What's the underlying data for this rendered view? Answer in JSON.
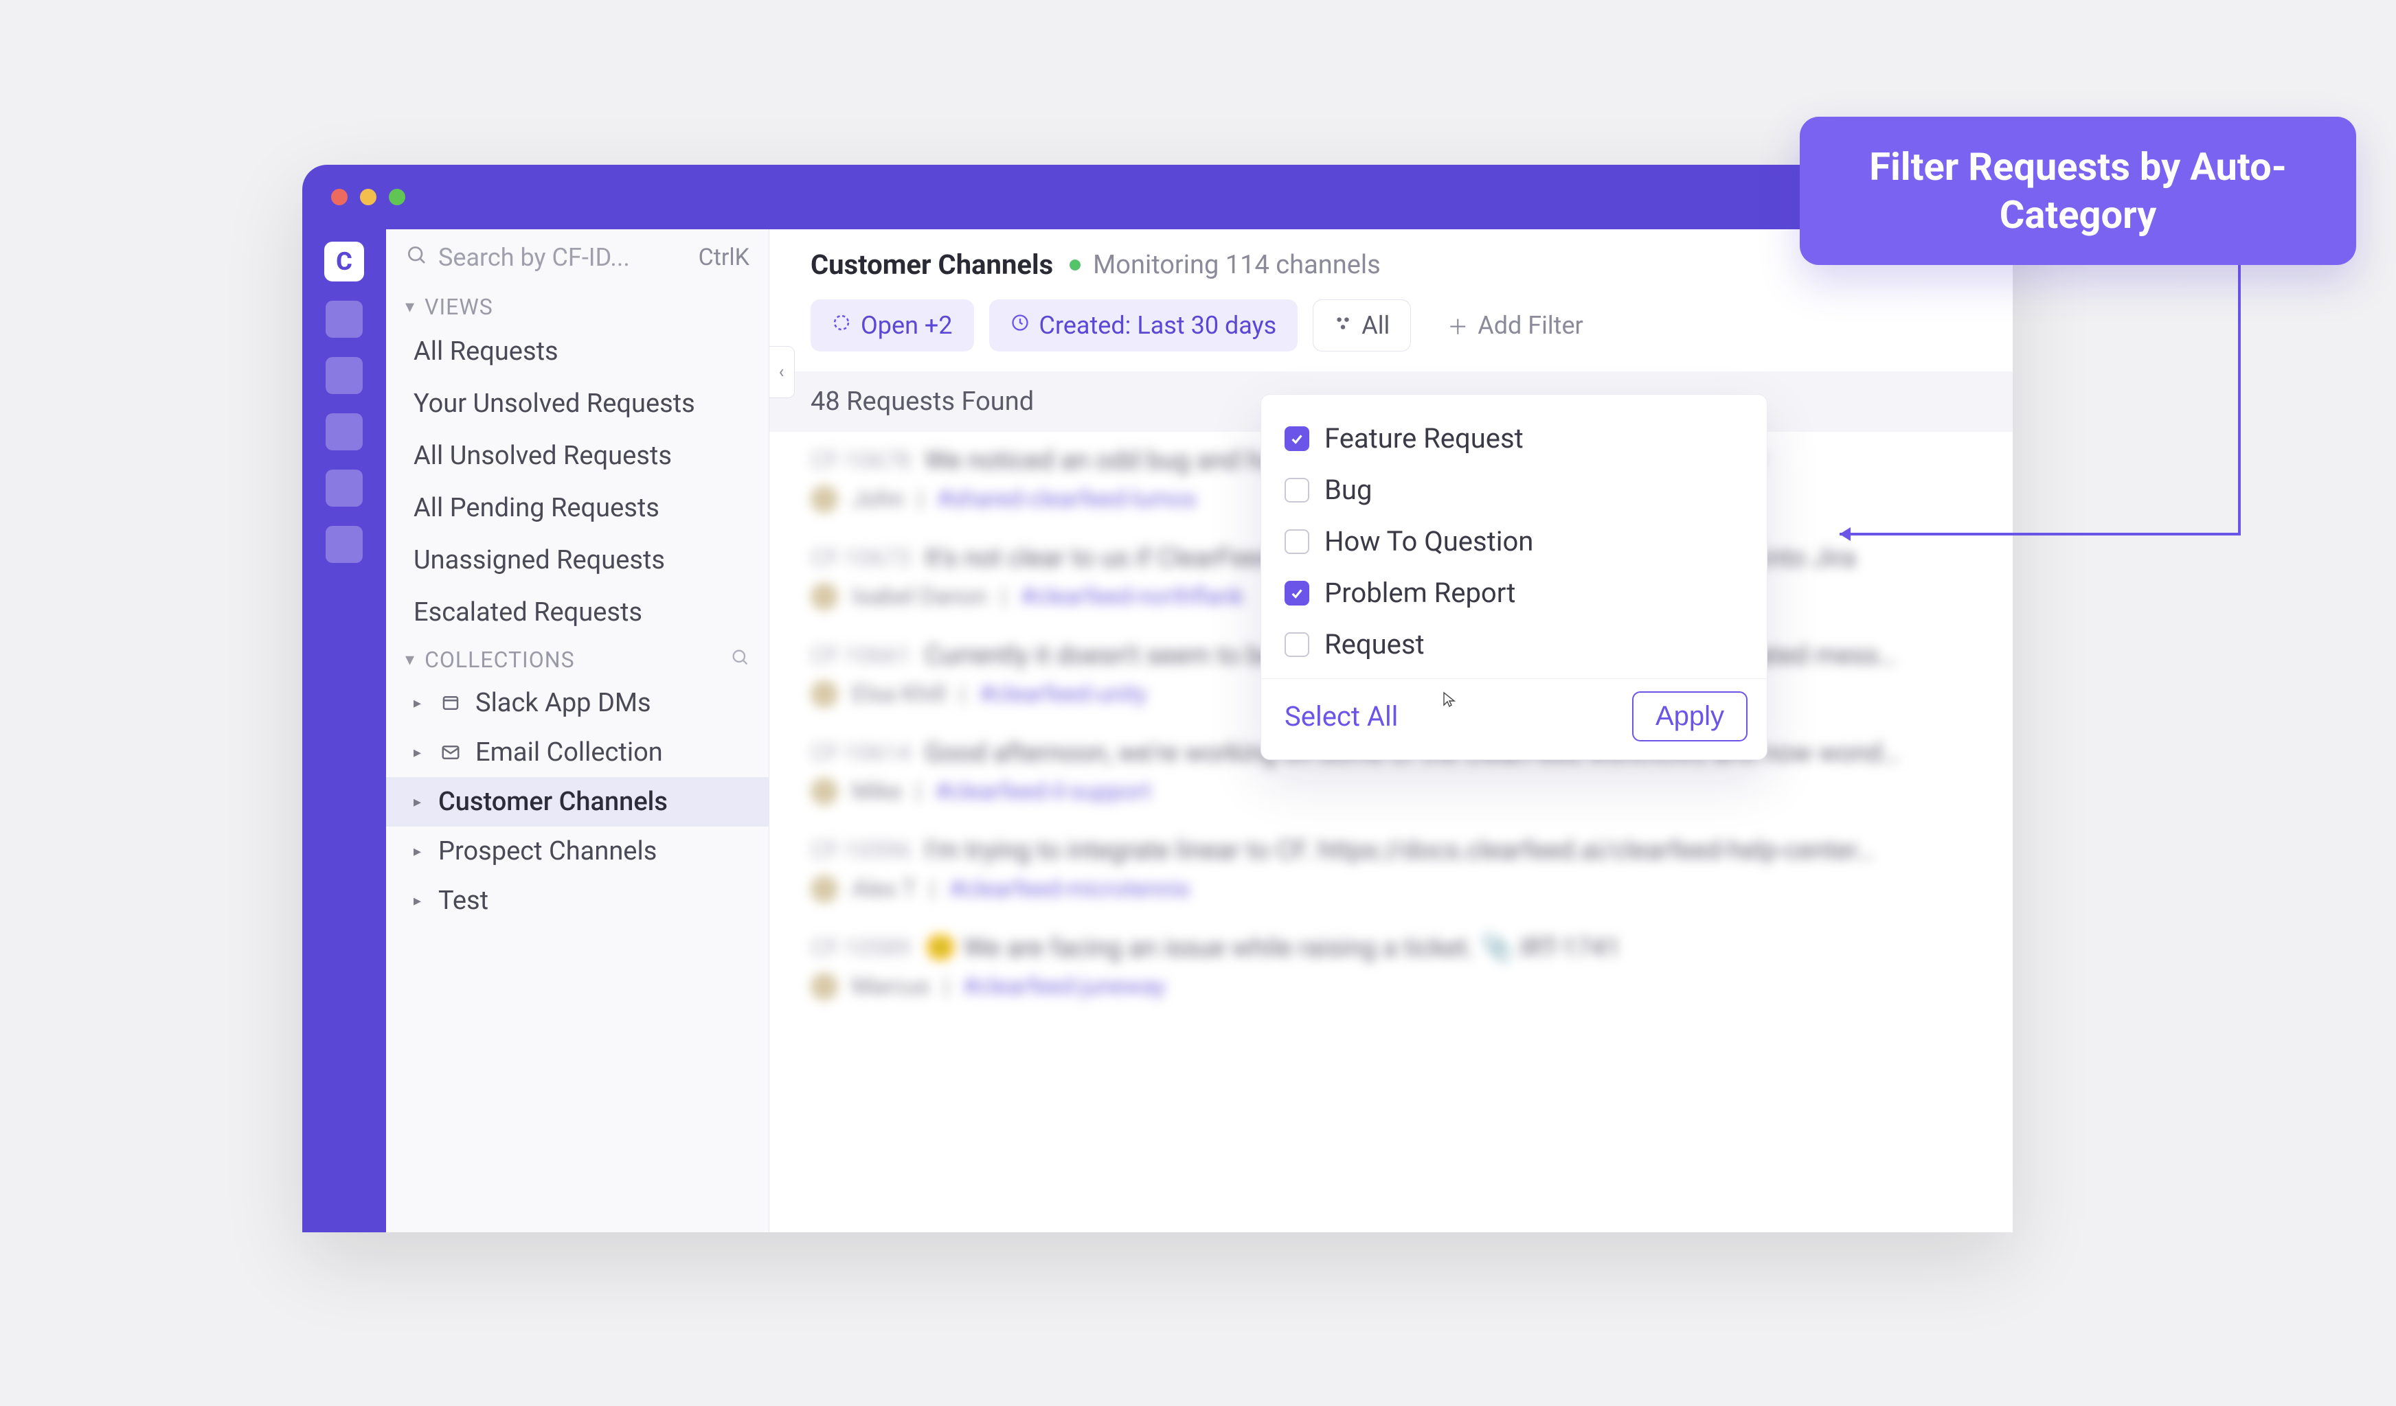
{
  "annotation": {
    "text": "Filter Requests by Auto-Category"
  },
  "search": {
    "placeholder": "Search by CF-ID...",
    "shortcut": "CtrlK"
  },
  "sidebar": {
    "views_label": "VIEWS",
    "views": [
      {
        "label": "All Requests"
      },
      {
        "label": "Your Unsolved Requests"
      },
      {
        "label": "All Unsolved Requests"
      },
      {
        "label": "All Pending Requests"
      },
      {
        "label": "Unassigned Requests"
      },
      {
        "label": "Escalated Requests"
      }
    ],
    "collections_label": "COLLECTIONS",
    "collections": [
      {
        "label": "Slack App DMs",
        "icon": "window"
      },
      {
        "label": "Email Collection",
        "icon": "mail"
      },
      {
        "label": "Customer Channels",
        "active": true
      },
      {
        "label": "Prospect Channels"
      },
      {
        "label": "Test"
      }
    ]
  },
  "header": {
    "title": "Customer Channels",
    "monitoring": "Monitoring 114 channels"
  },
  "filters": {
    "open": "Open +2",
    "created": "Created: Last 30 days",
    "all": "All",
    "add_filter": "Add Filter"
  },
  "results_bar": "48 Requests Found",
  "dropdown": {
    "options": [
      {
        "label": "Feature Request",
        "checked": true
      },
      {
        "label": "Bug",
        "checked": false
      },
      {
        "label": "How To Question",
        "checked": false
      },
      {
        "label": "Problem Report",
        "checked": true
      },
      {
        "label": "Request",
        "checked": false
      }
    ],
    "select_all": "Select All",
    "apply": "Apply"
  },
  "requests": [
    {
      "id": "CF-10678",
      "text": "We noticed an odd bug and have a question about the workflow behavior",
      "user": "John",
      "channel": "#shared-clearfeed-lumos"
    },
    {
      "id": "CF-10673",
      "text": "It's not clear to us if ClearFeed supports mapping of custom Slack fields into Jira",
      "user": "Isabel Danon",
      "channel": "#clearfeed-northflank"
    },
    {
      "id": "CF-10661",
      "text": "Currently it doesn't seem to be possible to create a ticket from an automated mess…",
      "user": "Elsa Khill",
      "channel": "#clearfeed-unity"
    },
    {
      "id": "CF-10614",
      "text": "Good afternoon, we're working on some of the ClearFeed workflows and now wond…",
      "user": "Mike",
      "channel": "#clearfeed-il-support"
    },
    {
      "id": "CF-10596",
      "text": "I'm trying to integrate linear to CF. https://docs.clearfeed.ai/clearfeed-help-center…",
      "user": "Alex T",
      "channel": "#clearfeed-microtennis"
    },
    {
      "id": "CF-10589",
      "text": "😕 We are facing an issue while raising a ticket.   📎 IRT-1741",
      "user": "Marcus",
      "channel": "#clearfeed-juneway"
    }
  ]
}
